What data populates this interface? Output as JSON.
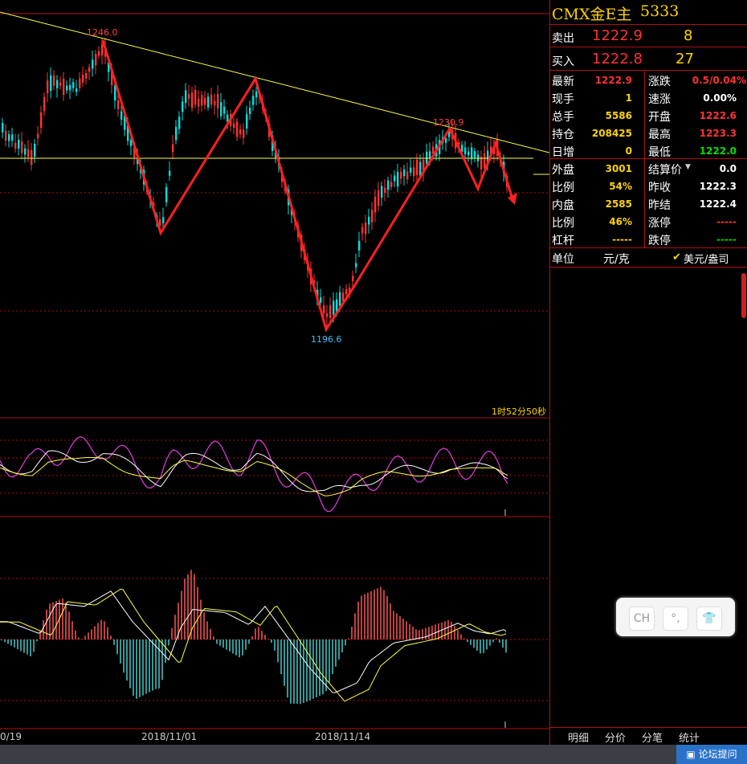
{
  "chart": {
    "annotations": {
      "high": "1246.0",
      "low": "1196.6",
      "mid_high": "1230.9"
    },
    "countdown": "1时52分50秒",
    "x_labels": [
      "0/19",
      "2018/11/01",
      "2018/11/14"
    ],
    "colors": {
      "up": "#00e0e0",
      "down": "#ff3333",
      "trend": "#ffff44",
      "arrow": "#ff2020",
      "grid": "#b01010",
      "macd_pos": "#ff5555",
      "macd_neg": "#44cccc",
      "kdj_j": "#e040e0"
    }
  },
  "panel": {
    "title_name": "CMX金E主",
    "title_code": "5333",
    "sell_label": "卖出",
    "sell_price": "1222.9",
    "sell_qty": "8",
    "buy_label": "买入",
    "buy_price": "1222.8",
    "buy_qty": "27",
    "rows": [
      {
        "l1": "最新",
        "v1": "1222.9",
        "l2": "涨跌",
        "v2": "0.5/0.04%"
      },
      {
        "l1": "现手",
        "v1": "1",
        "l2": "速涨",
        "v2": "0.00%"
      },
      {
        "l1": "总手",
        "v1": "5586",
        "l2": "开盘",
        "v2": "1222.6"
      },
      {
        "l1": "持仓",
        "v1": "208425",
        "l2": "最高",
        "v2": "1223.3"
      },
      {
        "l1": "日增",
        "v1": "0",
        "l2": "最低",
        "v2": "1222.0"
      },
      {
        "l1": "外盘",
        "v1": "3001",
        "l2": "结算价",
        "v2": "0.0"
      },
      {
        "l1": "比例",
        "v1": "54%",
        "l2": "昨收",
        "v2": "1222.3"
      },
      {
        "l1": "内盘",
        "v1": "2585",
        "l2": "昨结",
        "v2": "1222.4"
      },
      {
        "l1": "比例",
        "v1": "46%",
        "l2": "涨停",
        "v2": "-----"
      },
      {
        "l1": "杠杆",
        "v1": "-----",
        "l2": "跌停",
        "v2": "-----"
      }
    ],
    "unit_label": "单位",
    "unit_value": "元/克",
    "unit_alt": "美元/盎司",
    "float_buttons": [
      "CH",
      "°,",
      "👕"
    ],
    "tabs": [
      "明细",
      "分价",
      "分笔",
      "统计"
    ]
  },
  "footer": {
    "forum": "论坛提问"
  }
}
